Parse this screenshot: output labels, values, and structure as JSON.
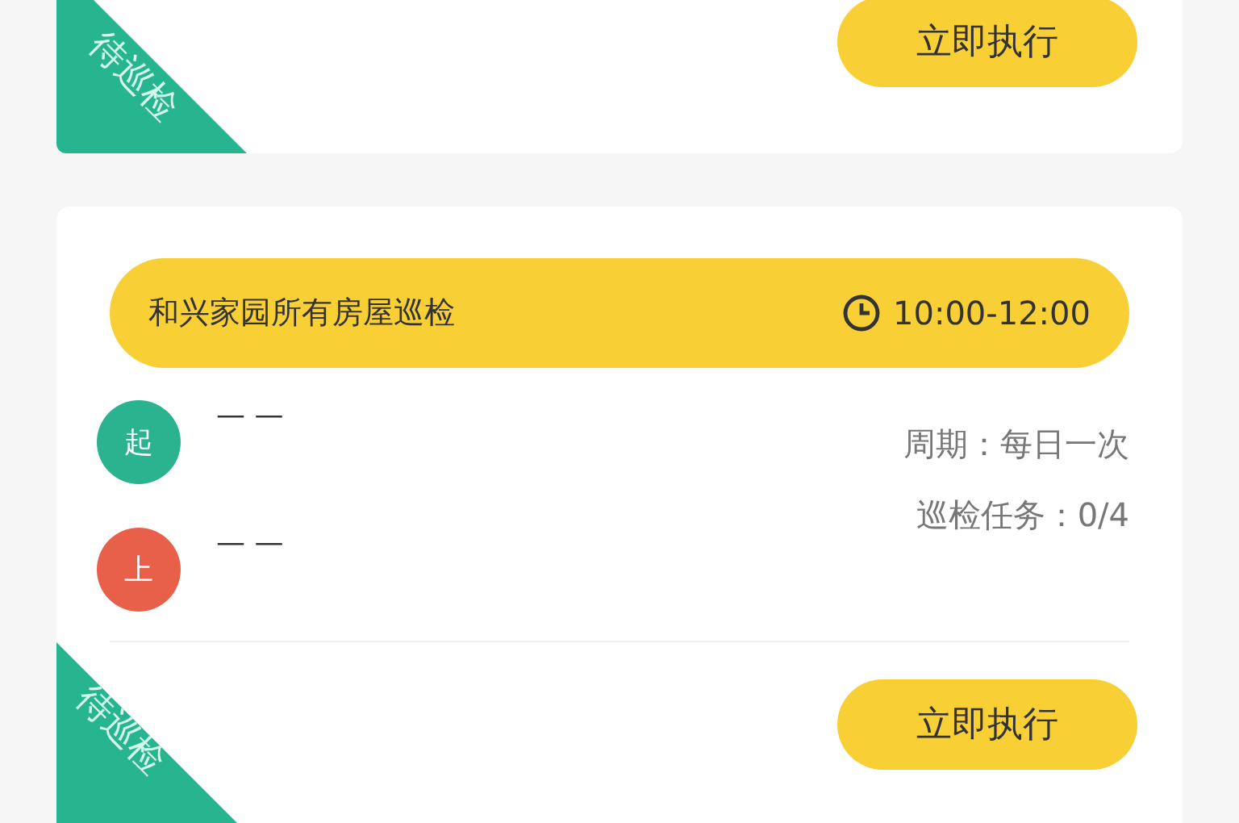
{
  "cards": [
    {
      "status": "待巡检",
      "action": "立即执行"
    },
    {
      "title": "和兴家园所有房屋巡检",
      "time": "10:00-12:00",
      "points": [
        {
          "mark": "起",
          "color": "#2bb38f",
          "text": "— —"
        },
        {
          "mark": "上",
          "color": "#e8604a",
          "text": "— —"
        }
      ],
      "period": "周期：每日一次",
      "progress": "巡检任务：0/4",
      "status": "待巡检",
      "action": "立即执行"
    }
  ]
}
